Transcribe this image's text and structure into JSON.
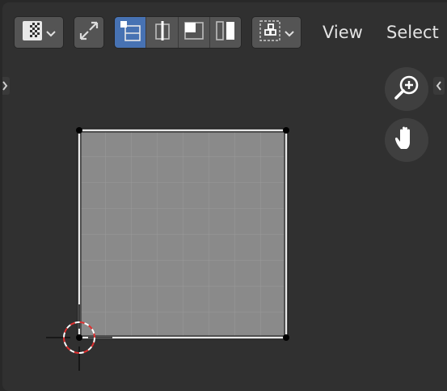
{
  "header": {
    "editor_type_icon": "image-editor-icon",
    "sync_icon": "uv-sync-selection-icon",
    "select_modes": [
      {
        "icon": "vertex-select-icon",
        "active": true
      },
      {
        "icon": "edge-select-icon",
        "active": false
      },
      {
        "icon": "face-select-icon",
        "active": false
      },
      {
        "icon": "island-select-icon",
        "active": false
      }
    ],
    "sticky_icon": "sticky-selection-icon",
    "menus": [
      "View",
      "Select"
    ]
  },
  "navigation": {
    "zoom_icon": "zoom-icon",
    "pan_icon": "pan-hand-icon"
  },
  "colors": {
    "background": "#303030",
    "uv_face": "#8a8a8a",
    "uv_edge": "#e8e8e8",
    "vertex": "#000000",
    "cursor_red": "#ff3030",
    "active_mode": "#4772b3"
  }
}
